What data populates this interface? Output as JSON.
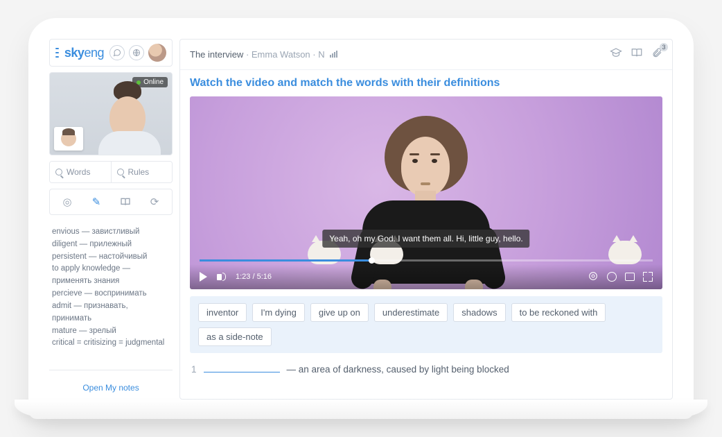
{
  "brand": {
    "sky": "sky",
    "eng": "eng"
  },
  "status": {
    "online": "Online"
  },
  "search": {
    "words_placeholder": "Words",
    "rules_placeholder": "Rules"
  },
  "vocab": [
    "envious — завистливый",
    "diligent — прилежный",
    "persistent — настойчивый",
    "to apply knowledge — применять знания",
    "percieve — воспринимать",
    "admit — признавать, принимать",
    "mature — зрелый",
    "critical = critisizing = judgmental"
  ],
  "sidebar": {
    "open_notes": "Open My notes"
  },
  "breadcrumb": {
    "lesson": "The interview",
    "topic": "Emma Watson",
    "level": "N",
    "attachments_count": "3"
  },
  "task": {
    "title": "Watch the video and match the words with their definitions"
  },
  "video": {
    "caption": "Yeah, oh my God. I want them all. Hi, little guy, hello.",
    "time_current": "1:23",
    "time_total": "5:16"
  },
  "bank": [
    "inventor",
    "I'm dying",
    "give up on",
    "underestimate",
    "shadows",
    "to be reckoned with",
    "as a side-note"
  ],
  "question": {
    "number": "1",
    "text": "— an area of darkness, caused by light being blocked"
  }
}
